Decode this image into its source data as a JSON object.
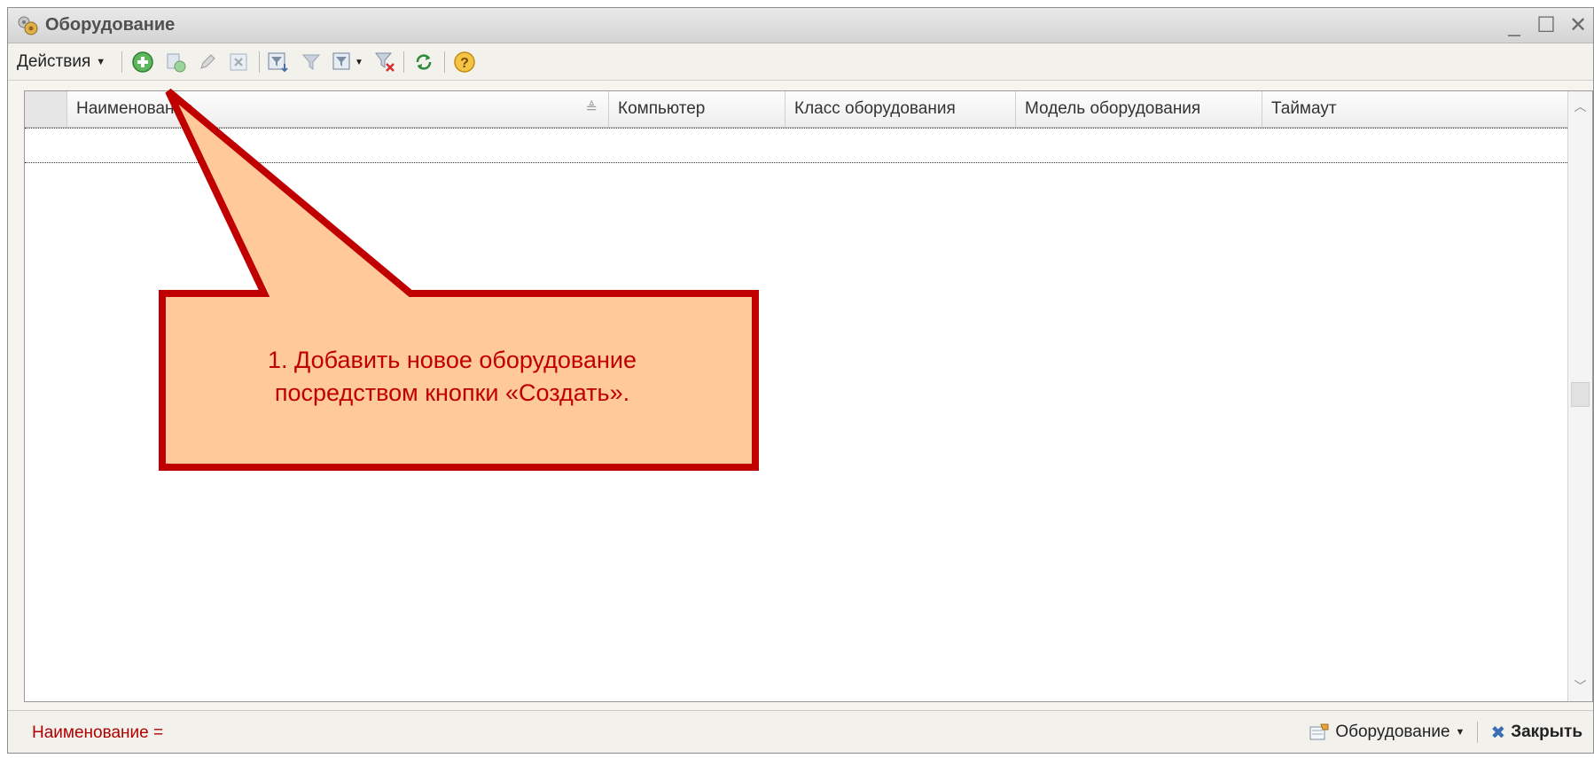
{
  "window": {
    "title": "Оборудование",
    "controls": [
      "_",
      "☐",
      "✕"
    ]
  },
  "toolbar": {
    "actions_label": "Действия",
    "icons": [
      "add-icon",
      "copy-icon",
      "edit-icon",
      "delete-icon",
      "filter-icon",
      "filter-disable-icon",
      "filter-history-icon",
      "filter-clear-icon",
      "refresh-icon",
      "help-icon"
    ]
  },
  "grid": {
    "columns": [
      "Наименование",
      "Компьютер",
      "Класс оборудования",
      "Модель оборудования",
      "Таймаут"
    ]
  },
  "status": {
    "filter": "Наименование =",
    "equipment_menu": "Оборудование",
    "close_label": "Закрыть"
  },
  "callout": {
    "line1": "1. Добавить новое оборудование",
    "line2": "посредством кнопки «Создать».",
    "fill": "#ffc99a",
    "border": "#c00000"
  }
}
